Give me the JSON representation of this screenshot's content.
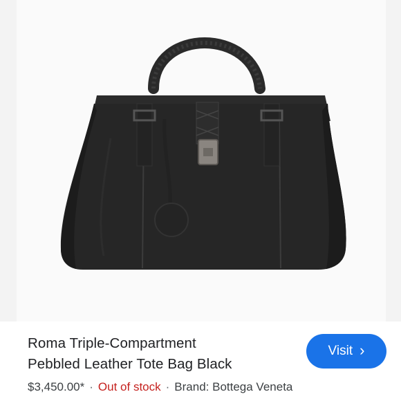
{
  "product": {
    "image_alt": "Black pebbled leather tote bag with woven top handles and gunmetal clasp",
    "title_line1": "Roma Triple-Compartment",
    "title_line2": "Pebbled Leather Tote Bag Black",
    "price": "$3,450.00*",
    "separator": "·",
    "stock_status": "Out of stock",
    "brand": "Brand: Bottega Veneta"
  },
  "actions": {
    "visit_label": "Visit",
    "visit_icon": "chevron-right-icon"
  },
  "colors": {
    "accent": "#1a73e8",
    "stock_status": "#c5221f",
    "text_primary": "#202124",
    "text_secondary": "#3c4043"
  }
}
